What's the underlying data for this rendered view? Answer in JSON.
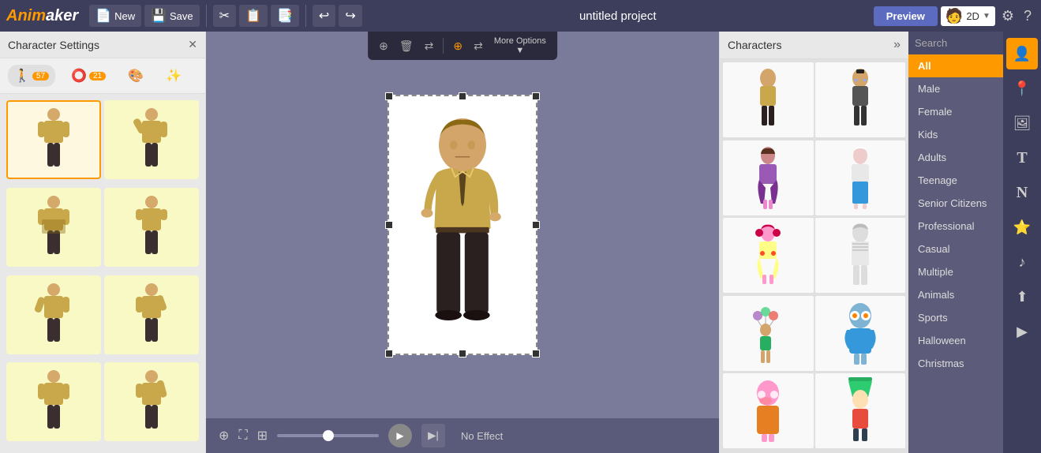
{
  "app": {
    "logo_text1": "Anim",
    "logo_text2": "aker",
    "project_title": "untitled project"
  },
  "toolbar": {
    "new_label": "New",
    "save_label": "Save",
    "preview_label": "Preview",
    "mode_label": "2D"
  },
  "panel": {
    "title": "Character Settings",
    "tab_poses_count": "57",
    "tab_props_count": "21"
  },
  "characters": {
    "panel_title": "Characters",
    "search_placeholder": "Search"
  },
  "categories": {
    "items": [
      {
        "label": "All",
        "active": true
      },
      {
        "label": "Male",
        "active": false
      },
      {
        "label": "Female",
        "active": false
      },
      {
        "label": "Kids",
        "active": false
      },
      {
        "label": "Adults",
        "active": false
      },
      {
        "label": "Teenage",
        "active": false
      },
      {
        "label": "Senior Citizens",
        "active": false
      },
      {
        "label": "Professional",
        "active": false
      },
      {
        "label": "Casual",
        "active": false
      },
      {
        "label": "Multiple",
        "active": false
      },
      {
        "label": "Animals",
        "active": false
      },
      {
        "label": "Sports",
        "active": false
      },
      {
        "label": "Halloween",
        "active": false
      },
      {
        "label": "Christmas",
        "active": false
      }
    ]
  },
  "bottom_bar": {
    "effect_label": "No Effect"
  },
  "icons": {
    "character_icon": "👤",
    "location_icon": "📍",
    "image_icon": "🖼",
    "text_icon": "T",
    "title_icon": "N",
    "star_icon": "★",
    "music_icon": "♪",
    "upload_icon": "⬆",
    "video_icon": "▶"
  }
}
